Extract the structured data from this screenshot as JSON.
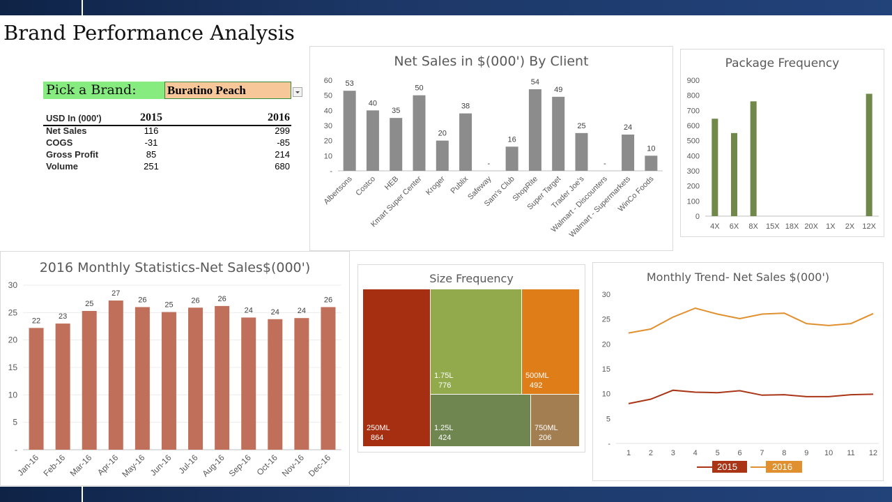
{
  "page_title": "Brand Performance Analysis",
  "selector": {
    "label": "Pick a Brand:",
    "value": "Buratino Peach"
  },
  "summary_table": {
    "header": [
      "USD In (000')",
      "2015",
      "2016"
    ],
    "rows": [
      {
        "label": "Net Sales",
        "y2015": "116",
        "y2016": "299"
      },
      {
        "label": "COGS",
        "y2015": "-31",
        "y2016": "-85"
      },
      {
        "label": "Gross Profit",
        "y2015": "85",
        "y2016": "214"
      },
      {
        "label": "Volume",
        "y2015": "251",
        "y2016": "680"
      }
    ]
  },
  "colors": {
    "gray_bar": "#8c8c8c",
    "green_bar": "#70884a",
    "red_bar": "#c0705a",
    "line_2015": "#a93516",
    "line_2016": "#e0902e"
  },
  "chart_data": [
    {
      "type": "bar",
      "title": "Net Sales in $(000') By Client",
      "categories": [
        "Albertsons",
        "Costco",
        "HEB",
        "Kmart Super Center",
        "Kroger",
        "Publix",
        "Safeway",
        "Sam's Club",
        "ShopRite",
        "Super Target",
        "Trader Joe's",
        "Walmart - Discounters",
        "Walmart - Supermarkets",
        "WinCo Foods"
      ],
      "values": [
        53,
        40,
        35,
        50,
        20,
        38,
        null,
        16,
        54,
        49,
        25,
        null,
        24,
        10
      ],
      "data_labels": [
        "53",
        "40",
        "35",
        "50",
        "20",
        "38",
        "-",
        "16",
        "54",
        "49",
        "25",
        "-",
        "24",
        "10"
      ],
      "y_ticks": [
        "-",
        "10",
        "20",
        "30",
        "40",
        "50",
        "60"
      ],
      "ylim": [
        0,
        60
      ]
    },
    {
      "type": "bar",
      "title": "Package Frequency",
      "categories": [
        "4X",
        "6X",
        "8X",
        "15X",
        "18X",
        "20X",
        "1X",
        "2X",
        "12X"
      ],
      "values": [
        645,
        550,
        760,
        0,
        0,
        0,
        0,
        0,
        810
      ],
      "y_ticks": [
        "0",
        "100",
        "200",
        "300",
        "400",
        "500",
        "600",
        "700",
        "800",
        "900"
      ],
      "ylim": [
        0,
        900
      ]
    },
    {
      "type": "bar",
      "title": "2016 Monthly Statistics-Net Sales$(000')",
      "categories": [
        "Jan-16",
        "Feb-16",
        "Mar-16",
        "Apr-16",
        "May-16",
        "Jun-16",
        "Jul-16",
        "Aug-16",
        "Sep-16",
        "Oct-16",
        "Nov-16",
        "Dec-16"
      ],
      "values": [
        22.2,
        23,
        25.3,
        27.2,
        26,
        25.1,
        25.9,
        26.2,
        24.1,
        23.8,
        24,
        26
      ],
      "data_labels": [
        "22",
        "23",
        "25",
        "27",
        "26",
        "25",
        "26",
        "26",
        "24",
        "24",
        "24",
        "26"
      ],
      "y_ticks": [
        "-",
        "5",
        "10",
        "15",
        "20",
        "25",
        "30"
      ],
      "ylim": [
        0,
        30
      ]
    },
    {
      "type": "treemap",
      "title": "Size Frequency",
      "items": [
        {
          "label": "250ML",
          "value": 864,
          "value_label": "864",
          "color": "#a52f10"
        },
        {
          "label": "1.75L",
          "value": 776,
          "value_label": "776",
          "color": "#92aa4c"
        },
        {
          "label": "500ML",
          "value": 492,
          "value_label": "492",
          "color": "#df7e18"
        },
        {
          "label": "1.25L",
          "value": 424,
          "value_label": "424",
          "color": "#6f8650"
        },
        {
          "label": "750ML",
          "value": 206,
          "value_label": "206",
          "color": "#a27e50"
        }
      ]
    },
    {
      "type": "line",
      "title": "Monthly Trend- Net Sales $(000')",
      "x": [
        1,
        2,
        3,
        4,
        5,
        6,
        7,
        8,
        9,
        10,
        11,
        12
      ],
      "series": [
        {
          "name": "2015",
          "values": [
            8.0,
            8.9,
            10.7,
            10.3,
            10.2,
            10.6,
            9.7,
            9.8,
            9.4,
            9.4,
            9.8,
            9.9
          ]
        },
        {
          "name": "2016",
          "values": [
            22.2,
            23.0,
            25.4,
            27.2,
            26.0,
            25.1,
            26.0,
            26.2,
            24.1,
            23.7,
            24.1,
            26.1
          ]
        }
      ],
      "y_ticks": [
        "-",
        "5",
        "10",
        "15",
        "20",
        "25",
        "30"
      ],
      "ylim": [
        0,
        30
      ],
      "legend": "bottom"
    }
  ]
}
